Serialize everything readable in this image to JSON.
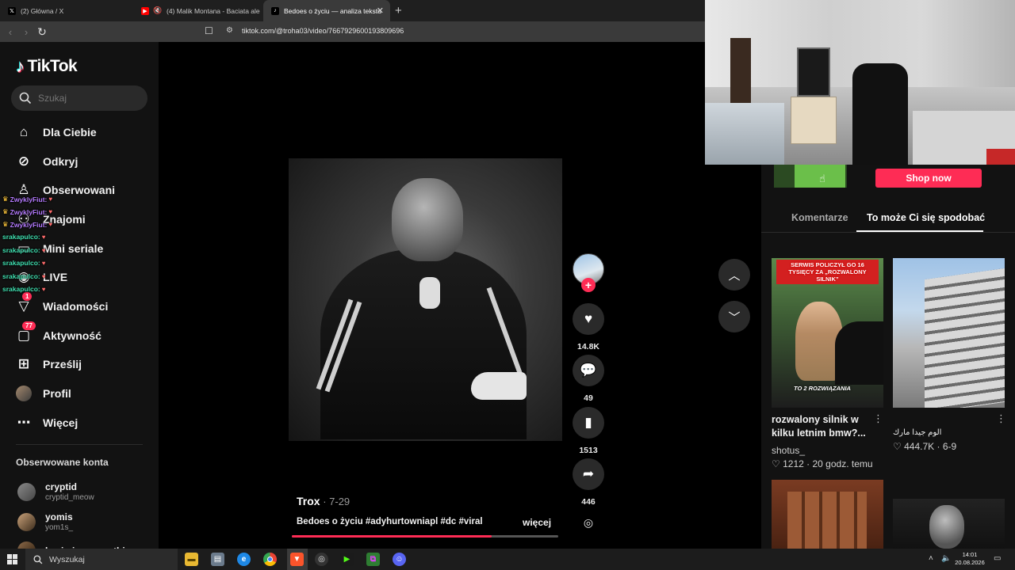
{
  "browser": {
    "tabs": [
      {
        "title": "(2) Główna / X",
        "icon": "x-logo-icon"
      },
      {
        "title": "(4) Malik Montana - Baciata ale t",
        "icon": "youtube-icon"
      },
      {
        "title": "Bedoes o życiu — analiza tekstu",
        "icon": "tiktok-icon",
        "active": true
      }
    ],
    "new_tab": "+",
    "url": "tiktok.com/@troha03/video/7667929600193809696"
  },
  "sidebar": {
    "brand": "TikTok",
    "search_placeholder": "Szukaj",
    "nav": [
      {
        "label": "Dla Ciebie",
        "icon": "home-icon"
      },
      {
        "label": "Odkryj",
        "icon": "compass-icon"
      },
      {
        "label": "Obserwowani",
        "icon": "following-icon"
      },
      {
        "label": "Znajomi",
        "icon": "friends-icon"
      },
      {
        "label": "Mini seriale",
        "icon": "series-icon"
      },
      {
        "label": "LIVE",
        "icon": "live-icon"
      },
      {
        "label": "Wiadomości",
        "icon": "messages-icon",
        "badge": "1"
      },
      {
        "label": "Aktywność",
        "icon": "activity-icon",
        "badge": "77"
      },
      {
        "label": "Prześlij",
        "icon": "upload-icon"
      },
      {
        "label": "Profil",
        "icon": "profile-icon"
      },
      {
        "label": "Więcej",
        "icon": "more-icon"
      }
    ],
    "following_title": "Obserwowane konta",
    "accounts": [
      {
        "name": "cryptid",
        "handle": "cryptid_meow"
      },
      {
        "name": "yomis",
        "handle": "yom1s_"
      },
      {
        "name": "bezimiennyzgothica",
        "handle": ""
      }
    ]
  },
  "chat": [
    {
      "user": "ZwyklyFiut:",
      "color": "#b57bff"
    },
    {
      "user": "ZwyklyFiut:",
      "color": "#b57bff"
    },
    {
      "user": "ZwyklyFiut:",
      "color": "#b57bff"
    },
    {
      "user": "srakapulco:",
      "color": "#40e0b0"
    },
    {
      "user": "srakapulco:",
      "color": "#40e0b0"
    },
    {
      "user": "srakapulco:",
      "color": "#40e0b0"
    },
    {
      "user": "srakapulco:",
      "color": "#40e0b0"
    },
    {
      "user": "srakapulco:",
      "color": "#40e0b0"
    }
  ],
  "video": {
    "author": "Trox",
    "date": " · 7-29",
    "description": "Bedoes o życiu #adyhurtowniapl #dc #viral",
    "more": "więcej",
    "progress": 0.75,
    "likes": "14.8K",
    "comments": "49",
    "saves": "1513",
    "shares": "446"
  },
  "right_panel": {
    "shop_label": "Shop now",
    "tabs": [
      "Komentarze",
      "To może Ci się spodobać"
    ],
    "recommendations": [
      {
        "caption": "SERWIS POLICZYŁ GO 16 TYSIĘCY ZA „ROZWALONY SILNIK”",
        "caption2": "TO 2 ROZWIĄZANIA",
        "title": "rozwalony silnik w kilku letnim bmw?...",
        "author": "shotus_",
        "likes": "1212",
        "time": "20 godz. temu"
      },
      {
        "title": "الوم جيدا مارك",
        "likes": "444.7K",
        "time": "6-9"
      }
    ]
  },
  "taskbar": {
    "search": "Wyszukaj",
    "time": "14:01",
    "date": "20.08.2026"
  },
  "colors": {
    "accent": "#fe2c55",
    "background": "#000000",
    "panel": "#121212"
  }
}
